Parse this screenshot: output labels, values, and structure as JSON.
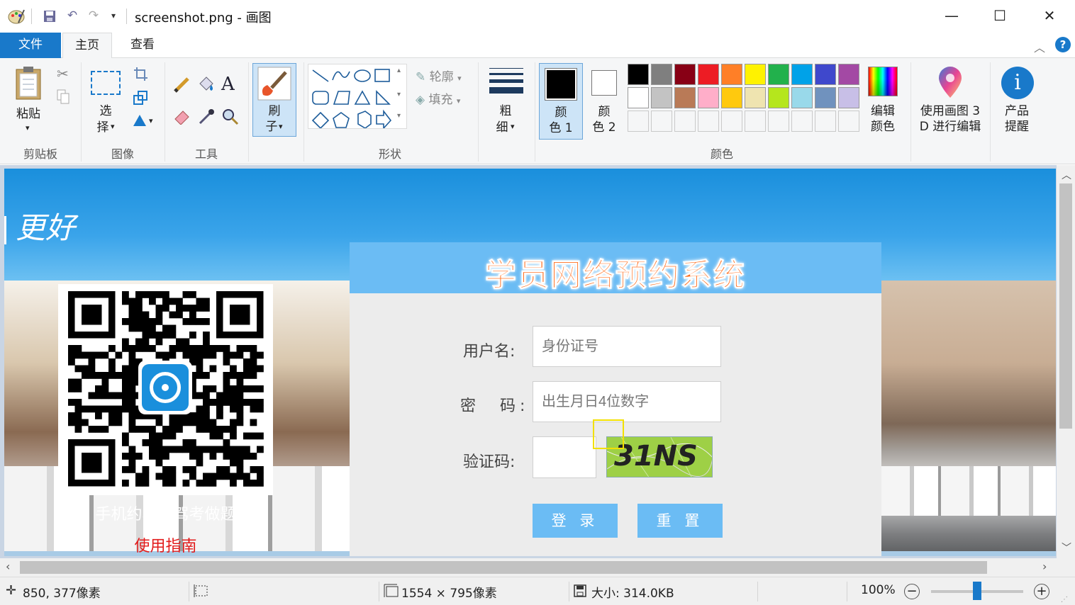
{
  "window": {
    "title": "screenshot.png - 画图",
    "minimize_glyph": "—",
    "maximize_glyph": "☐",
    "close_glyph": "✕"
  },
  "tabs": {
    "file": "文件",
    "home": "主页",
    "view": "查看"
  },
  "ribbon": {
    "clipboard": {
      "paste": "粘贴",
      "group": "剪贴板"
    },
    "image": {
      "select_1": "选",
      "select_2": "择",
      "group": "图像"
    },
    "tools": {
      "group": "工具"
    },
    "brushes": {
      "label_1": "刷",
      "label_2": "子"
    },
    "shapes": {
      "outline": "轮廓",
      "fill": "填充",
      "group": "形状"
    },
    "size": {
      "label_1": "粗",
      "label_2": "细"
    },
    "color1": {
      "label_1": "颜",
      "label_2": "色 1"
    },
    "color2": {
      "label_1": "颜",
      "label_2": "色 2"
    },
    "edit_colors": {
      "label_1": "编辑",
      "label_2": "颜色"
    },
    "paint3d": {
      "label_1": "使用画图 3",
      "label_2": "D 进行编辑"
    },
    "product_alert": {
      "label_1": "产品",
      "label_2": "提醒"
    },
    "colors_group": "颜色",
    "palette_row1": [
      "#000000",
      "#7f7f7f",
      "#880015",
      "#ed1c24",
      "#ff7f27",
      "#fff200",
      "#22b14c",
      "#00a2e8",
      "#3f48cc",
      "#a349a4"
    ],
    "palette_row2": [
      "#ffffff",
      "#c3c3c3",
      "#b97a57",
      "#ffaec9",
      "#ffc90e",
      "#efe4b0",
      "#b5e61d",
      "#99d9ea",
      "#7092be",
      "#c8bfe7"
    ]
  },
  "canvas_image": {
    "slogan": "更好",
    "system_title": "学员网络预约系统",
    "qr_caption": "手机约车、驾考做题",
    "guide_link": "使用指南",
    "username_label": "用户名:",
    "username_placeholder": "身份证号",
    "password_label": "密　码:",
    "password_placeholder": "出生月日4位数字",
    "captcha_label": "验证码:",
    "captcha_text": "31NS",
    "login_button": "登 录",
    "reset_button": "重 置"
  },
  "status": {
    "cursor_pos": "850, 377像素",
    "image_size": "1554 × 795像素",
    "file_size": "大小: 314.0KB",
    "zoom": "100%",
    "zoom_level": 1.0
  }
}
